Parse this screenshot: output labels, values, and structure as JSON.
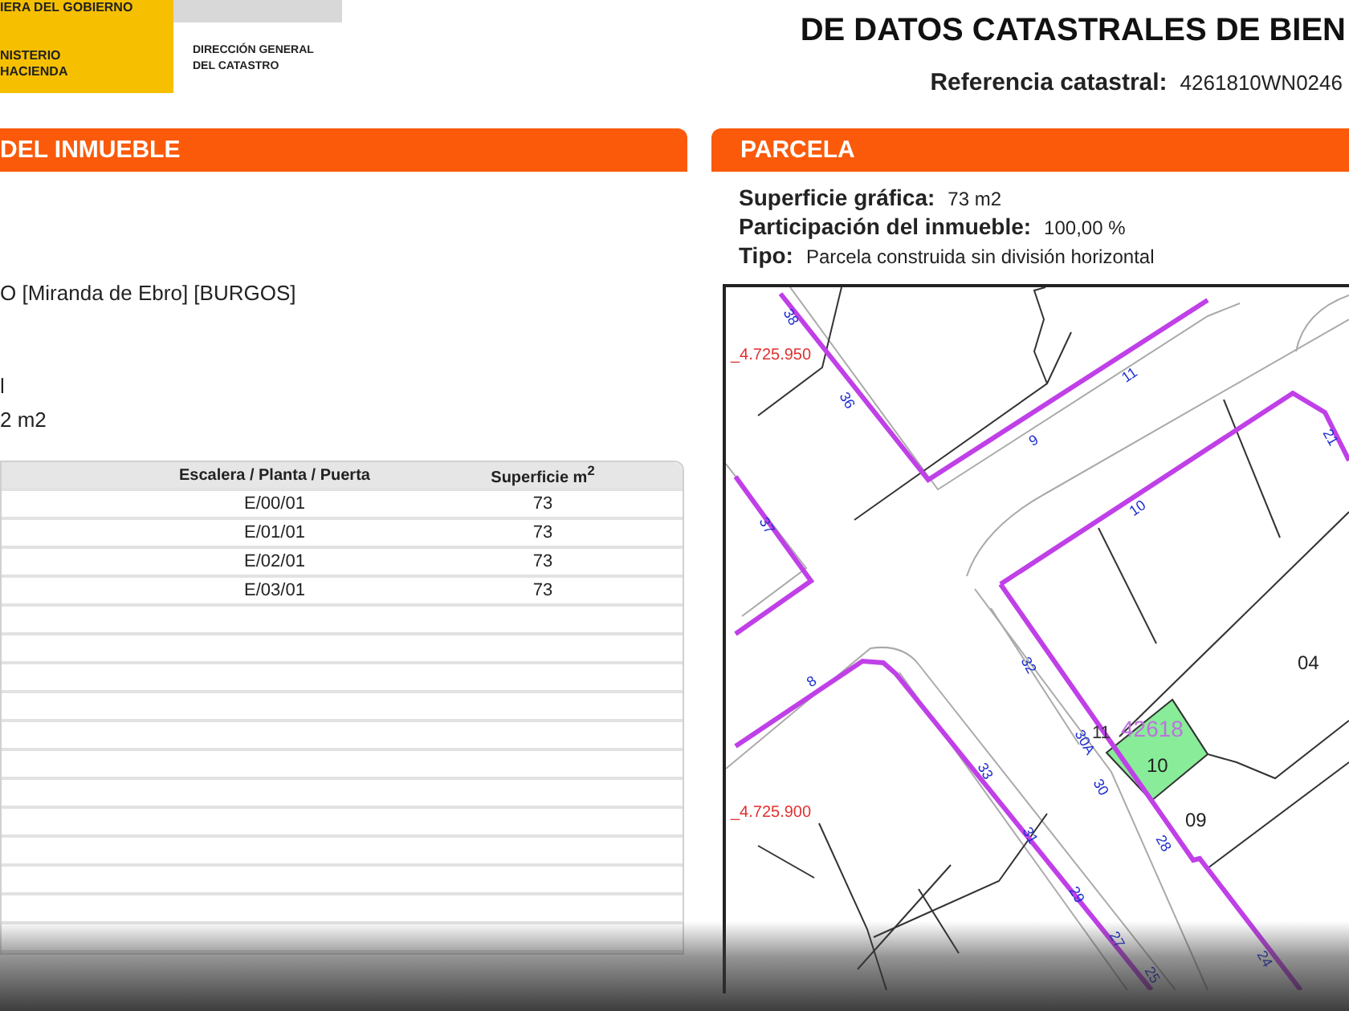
{
  "header": {
    "government": "IERA DEL GOBIERNO",
    "ministry": [
      "NISTERIO",
      "HACIENDA"
    ],
    "directorate": [
      "DIRECCIÓN GENERAL",
      "DEL CATASTRO"
    ],
    "title": "DE DATOS CATASTRALES DE BIEN",
    "reference": {
      "label": "Referencia catastral:",
      "value": "4261810WN0246"
    }
  },
  "property_panel": {
    "title": "DEL INMUEBLE",
    "fields": [
      "O [Miranda de Ebro] [BURGOS]",
      "l",
      "2 m2"
    ],
    "table": {
      "columns": [
        "Escalera / Planta / Puerta",
        "Superficie m$^{2}$"
      ],
      "rows": [
        [
          "E/00/01",
          "73"
        ],
        [
          "E/01/01",
          "73"
        ],
        [
          "E/02/01",
          "73"
        ],
        [
          "E/03/01",
          "73"
        ]
      ]
    }
  },
  "parcel_panel": {
    "title": "PARCELA",
    "fields": [
      {
        "label": "Superficie gráfica:",
        "value": "73 m2"
      },
      {
        "label": "Participación del inmueble:",
        "value": "100,00 %"
      },
      {
        "label": "Tipo:",
        "value": "Parcela construida sin división horizontal"
      }
    ],
    "map": {
      "coordinates": [
        "_4.725.950",
        "_4.725.900"
      ],
      "parcel_labels": [
        "42618",
        "11",
        "10",
        "04",
        "09"
      ],
      "house_numbers": [
        "38",
        "36",
        "9",
        "11",
        "10",
        "21",
        "37",
        "8",
        "32",
        "30A",
        "30",
        "33",
        "31",
        "29",
        "28",
        "27",
        "25",
        "24"
      ]
    }
  }
}
